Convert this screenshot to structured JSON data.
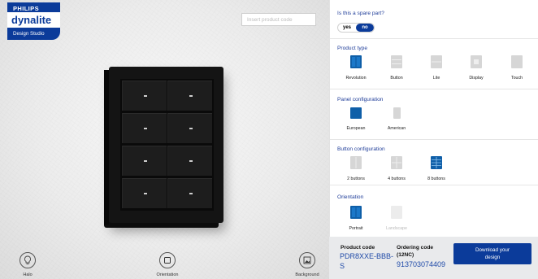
{
  "brand": {
    "philips": "PHILIPS",
    "dynalite": "dynalite",
    "studio": "Design Studio"
  },
  "viewer": {
    "product_code_placeholder": "Insert product code",
    "buttons": [
      {
        "label": "Halo",
        "icon": "bulb-icon"
      },
      {
        "label": "Orientation",
        "icon": "frame-icon"
      },
      {
        "label": "Background",
        "icon": "image-icon"
      }
    ]
  },
  "spare_part": {
    "title": "Is this a spare part?",
    "yes": "yes",
    "no": "no",
    "selected": "no"
  },
  "product_type": {
    "title": "Product type",
    "options": [
      {
        "label": "Revolution",
        "icon": "revolution-icon",
        "selected": true
      },
      {
        "label": "Button",
        "icon": "button-panel-icon",
        "selected": false
      },
      {
        "label": "Lite",
        "icon": "lite-panel-icon",
        "selected": false
      },
      {
        "label": "Display",
        "icon": "display-panel-icon",
        "selected": false
      },
      {
        "label": "Touch",
        "icon": "touch-panel-icon",
        "selected": false
      }
    ]
  },
  "panel_config": {
    "title": "Panel configuration",
    "options": [
      {
        "label": "European",
        "icon": "european-panel-icon",
        "selected": true
      },
      {
        "label": "American",
        "icon": "american-panel-icon",
        "selected": false
      }
    ]
  },
  "button_config": {
    "title": "Button configuration",
    "options": [
      {
        "label": "2 buttons",
        "icon": "two-buttons-icon",
        "selected": false
      },
      {
        "label": "4 buttons",
        "icon": "four-buttons-icon",
        "selected": false
      },
      {
        "label": "8 buttons",
        "icon": "eight-buttons-icon",
        "selected": true
      }
    ]
  },
  "orientation": {
    "title": "Orientation",
    "options": [
      {
        "label": "Portrait",
        "icon": "portrait-icon",
        "selected": true
      },
      {
        "label": "Landscape",
        "icon": "landscape-icon",
        "selected": false,
        "disabled": true
      }
    ]
  },
  "footer": {
    "product_code_label": "Product code",
    "product_code_line1": "PDR8XXE-BBB-",
    "product_code_line2": "S",
    "ordering_code_label": "Ordering code",
    "ordering_code_sub": "(12NC)",
    "ordering_code_value": "913703074409",
    "download_line1": "Download your",
    "download_line2": "design"
  },
  "colors": {
    "brand_blue": "#0b3b9a",
    "accent_blue": "#1f4aa8",
    "selected_icon": "#0f5fa8",
    "unselected_icon": "#d6d6d6"
  }
}
